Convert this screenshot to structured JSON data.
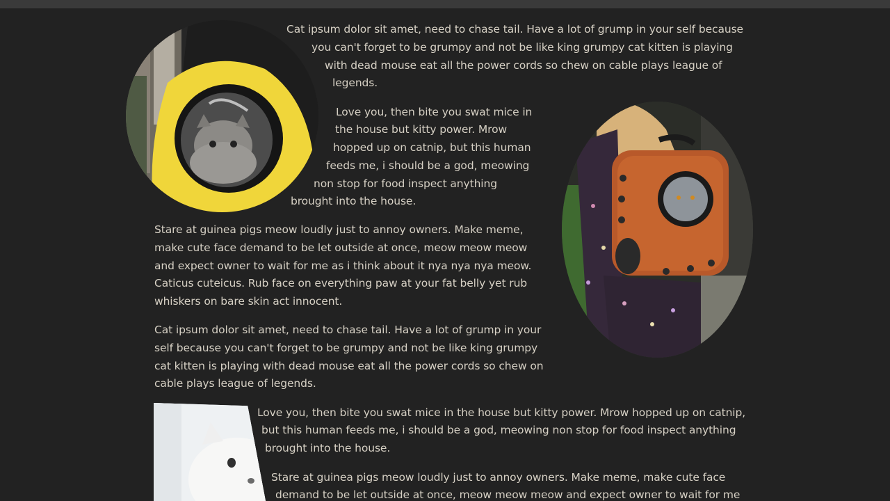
{
  "paragraphs": [
    {
      "lines": [
        "Cat ipsum dolor sit amet, need to chase tail. Have a lot of grump in your self because",
        "you can't forget to be grumpy and not be like king grumpy cat kitten is playing",
        "with dead mouse eat all the power cords so chew on cable plays league of",
        "legends."
      ]
    },
    {
      "lines": [
        "Love you, then bite you swat mice in",
        "the house but kitty power. Mrow",
        "hopped up on catnip, but this human",
        "feeds me, i should be a god, meowing",
        "non stop for food inspect anything",
        "brought into the house."
      ]
    },
    {
      "lines": [
        "Stare at guinea pigs meow loudly just to annoy owners. Make meme,",
        "make cute face demand to be let outside at once, meow meow meow",
        "and expect owner to wait for me as i think about it nya nya nya meow.",
        "Caticus cuteicus. Rub face on everything paw at your fat belly yet rub",
        "whiskers on bare skin act innocent."
      ]
    },
    {
      "lines": [
        "Cat ipsum dolor sit amet, need to chase tail. Have a lot of grump in your",
        "self because you can't forget to be grumpy and not be like king grumpy",
        "cat kitten is playing with dead mouse eat all the power cords so chew on",
        "cable plays league of legends."
      ]
    },
    {
      "lines": [
        "Love you, then bite you swat mice in the house but kitty power. Mrow hopped up on catnip,",
        "but this human feeds me, i should be a god, meowing non stop for food inspect anything",
        "brought into the house."
      ]
    },
    {
      "lines": [
        "Stare at guinea pigs meow loudly just to annoy owners. Make meme, make cute face",
        "demand to be let outside at once, meow meow meow and expect owner to wait for me"
      ]
    }
  ],
  "images": {
    "cat_bubble_yellow": "cat in yellow bubble backpack",
    "cat_backpack_orange": "cat in orange backpack",
    "white_cat": "white fluffy cat"
  },
  "colors": {
    "background": "#222222",
    "text": "#d6d0c4"
  }
}
